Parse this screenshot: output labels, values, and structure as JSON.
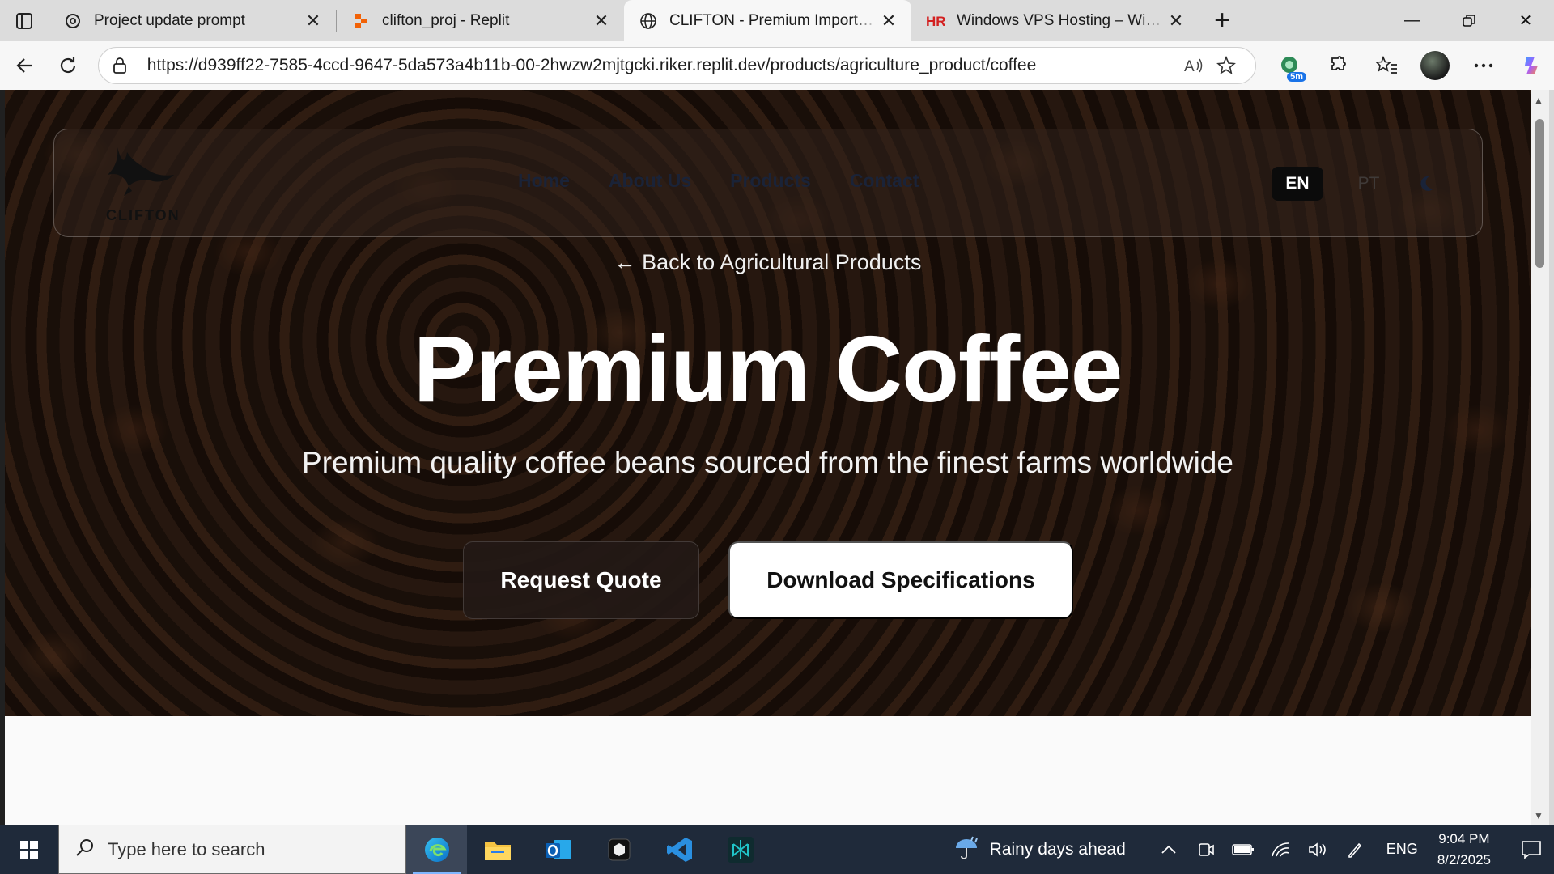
{
  "browser": {
    "tabs": [
      {
        "title": "Project update prompt",
        "icon": "chatgpt-icon",
        "active": false
      },
      {
        "title": "clifton_proj - Replit",
        "icon": "replit-icon",
        "active": false
      },
      {
        "title": "CLIFTON - Premium Import Export",
        "icon": "globe-icon",
        "active": true
      },
      {
        "title": "Windows VPS Hosting – Windows",
        "icon": "hr-icon",
        "active": false
      }
    ],
    "url": "https://d939ff22-7585-4ccd-9647-5da573a4b11b-00-2hwzw2mjtgcki.riker.replit.dev/products/agriculture_product/coffee",
    "extension_badge": "5m"
  },
  "site": {
    "logo_text": "CLIFTON",
    "nav": [
      "Home",
      "About Us",
      "Products",
      "Contact"
    ],
    "lang_active": "EN",
    "lang_other": "PT",
    "back_link": "← Back to Agricultural Products",
    "title": "Premium Coffee",
    "subtitle": "Premium quality coffee beans sourced from the finest farms worldwide",
    "primary_button": "Request Quote",
    "secondary_button": "Download Specifications"
  },
  "taskbar": {
    "search_placeholder": "Type here to search",
    "weather": "Rainy days ahead",
    "language": "ENG",
    "time": "9:04 PM",
    "date": "8/2/2025"
  },
  "colors": {
    "accent": "#1a73e8",
    "hero_overlay": "#2a1a12",
    "nav_link": "#1a2338"
  }
}
